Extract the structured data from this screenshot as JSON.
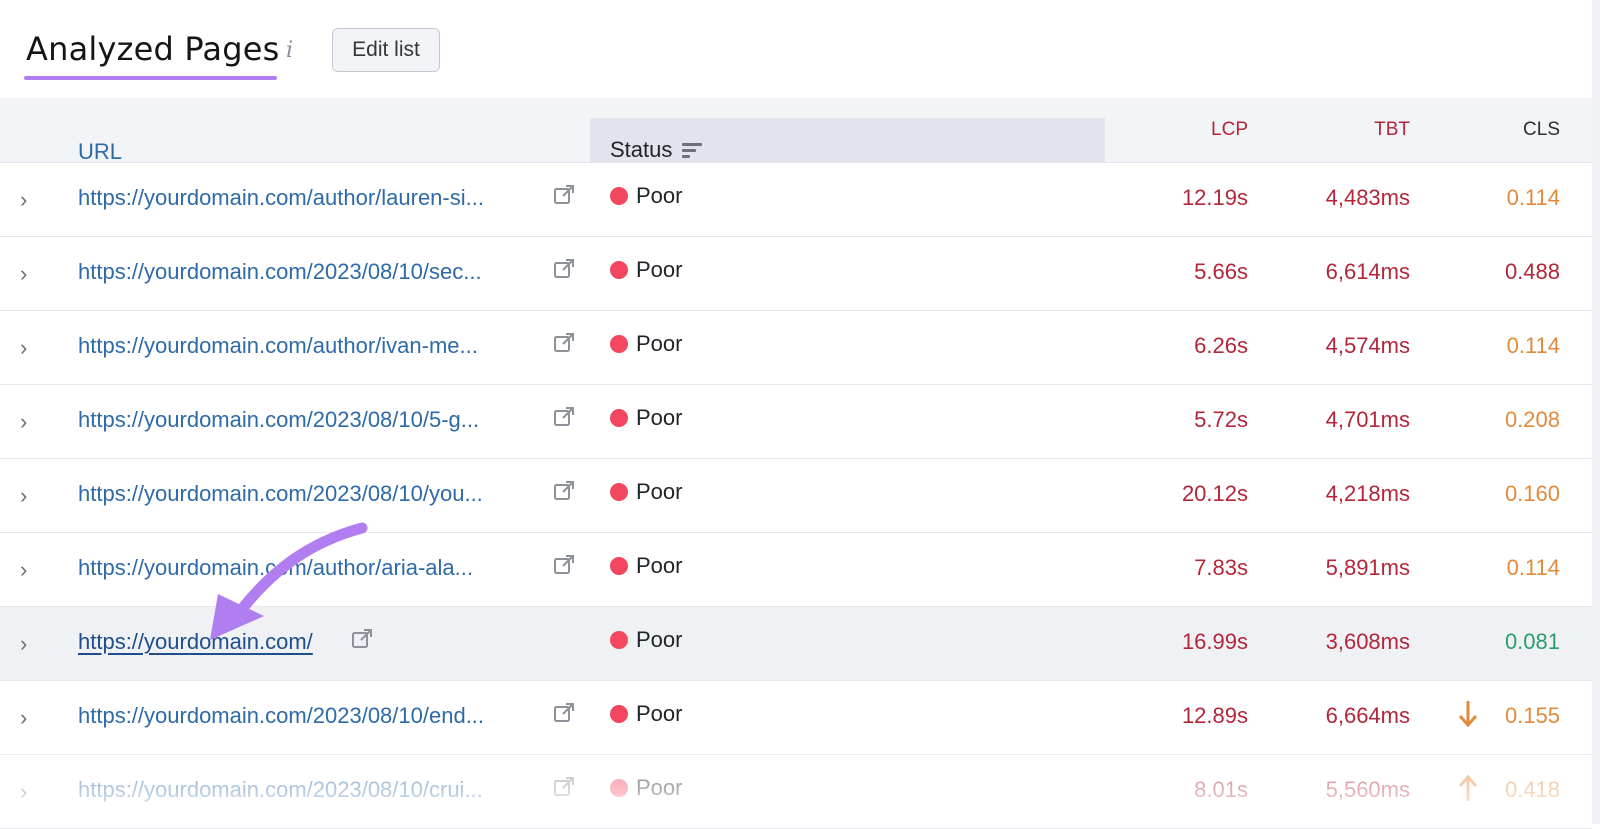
{
  "header": {
    "title": "Analyzed Pages",
    "info_icon": "i",
    "edit_button": "Edit list"
  },
  "columns": {
    "url": "URL",
    "status": "Status",
    "lcp": "LCP",
    "tbt": "TBT",
    "cls": "CLS"
  },
  "colors": {
    "poor": "#f2475f",
    "bad_value": "#b3263a",
    "warn_value": "#e38a3a",
    "good_value": "#2a9d6f",
    "accent": "#b07ef0",
    "link": "#2e6aa8"
  },
  "rows": [
    {
      "url": "https://yourdomain.com/author/lauren-si...",
      "status": "Poor",
      "lcp": "12.19s",
      "tbt": "4,483ms",
      "cls": "0.114",
      "cls_level": "warn",
      "cls_trend": ""
    },
    {
      "url": "https://yourdomain.com/2023/08/10/sec...",
      "status": "Poor",
      "lcp": "5.66s",
      "tbt": "6,614ms",
      "cls": "0.488",
      "cls_level": "bad",
      "cls_trend": ""
    },
    {
      "url": "https://yourdomain.com/author/ivan-me...",
      "status": "Poor",
      "lcp": "6.26s",
      "tbt": "4,574ms",
      "cls": "0.114",
      "cls_level": "warn",
      "cls_trend": ""
    },
    {
      "url": "https://yourdomain.com/2023/08/10/5-g...",
      "status": "Poor",
      "lcp": "5.72s",
      "tbt": "4,701ms",
      "cls": "0.208",
      "cls_level": "warn",
      "cls_trend": ""
    },
    {
      "url": "https://yourdomain.com/2023/08/10/you...",
      "status": "Poor",
      "lcp": "20.12s",
      "tbt": "4,218ms",
      "cls": "0.160",
      "cls_level": "warn",
      "cls_trend": ""
    },
    {
      "url": "https://yourdomain.com/author/aria-ala...",
      "status": "Poor",
      "lcp": "7.83s",
      "tbt": "5,891ms",
      "cls": "0.114",
      "cls_level": "warn",
      "cls_trend": ""
    },
    {
      "url": "https://yourdomain.com/",
      "status": "Poor",
      "lcp": "16.99s",
      "tbt": "3,608ms",
      "cls": "0.081",
      "cls_level": "good",
      "cls_trend": "",
      "highlighted": true
    },
    {
      "url": "https://yourdomain.com/2023/08/10/end...",
      "status": "Poor",
      "lcp": "12.89s",
      "tbt": "6,664ms",
      "cls": "0.155",
      "cls_level": "warn",
      "cls_trend": "down"
    },
    {
      "url": "https://yourdomain.com/2023/08/10/crui...",
      "status": "Poor",
      "lcp": "8.01s",
      "tbt": "5,560ms",
      "cls": "0.418",
      "cls_level": "warn",
      "cls_trend": "up"
    }
  ]
}
